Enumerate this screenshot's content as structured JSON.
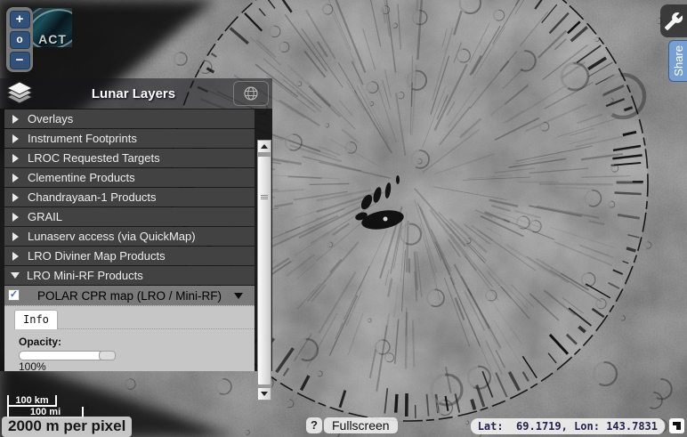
{
  "zoom_controls": {
    "zoom_in": "+",
    "reset": "o",
    "zoom_out": "−"
  },
  "logo": {
    "label": "ACT"
  },
  "toolbar": {
    "share_label": "Share"
  },
  "layers_panel": {
    "title": "Lunar Layers",
    "items": [
      {
        "label": "Overlays",
        "expanded": false
      },
      {
        "label": "Instrument Footprints",
        "expanded": false
      },
      {
        "label": "LROC Requested Targets",
        "expanded": false
      },
      {
        "label": "Clementine Products",
        "expanded": false
      },
      {
        "label": "Chandrayaan-1 Products",
        "expanded": false
      },
      {
        "label": "GRAIL",
        "expanded": false
      },
      {
        "label": "Lunaserv access (via QuickMap)",
        "expanded": false
      },
      {
        "label": "LRO Diviner Map Products",
        "expanded": false
      },
      {
        "label": "LRO Mini-RF Products",
        "expanded": true
      }
    ],
    "sublayer": {
      "label": "POLAR CPR map (LRO / Mini-RF)",
      "checked": true,
      "checkmark": "✓"
    },
    "detail": {
      "tab_label": "Info",
      "opacity_label": "Opacity:",
      "opacity_percent": "100%",
      "opacity_value": 100
    }
  },
  "status": {
    "scale_km": "100 km",
    "scale_mi": "100 mi",
    "resolution": "2000 m per pixel",
    "help": "?",
    "fullscreen": "Fullscreen",
    "position": "Lat:  69.1719, Lon: 143.7831"
  },
  "colors": {
    "accent_blue": "#76a0d3",
    "control_navy": "#31517a",
    "panel_row_gray": "#424242",
    "selected_layer_gray": "#7a7a7a",
    "info_panel_gray": "#c6c6c6"
  }
}
